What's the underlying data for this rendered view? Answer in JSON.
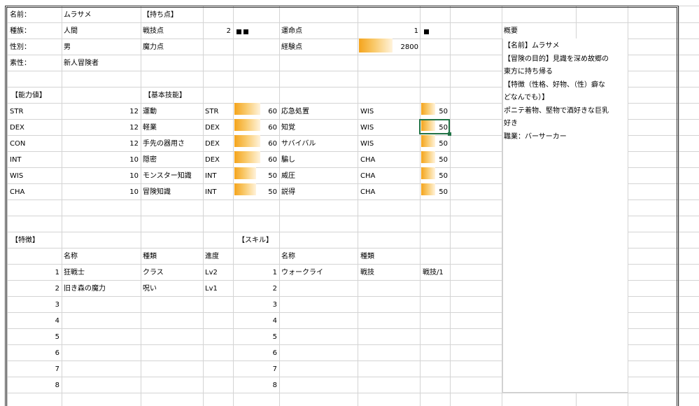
{
  "profile": {
    "name_label": "名前：",
    "name_value": "ムラサメ",
    "race_label": "種族：",
    "race_value": "人間",
    "gender_label": "性別：",
    "gender_value": "男",
    "origin_label": "素性：",
    "origin_value": "新人冒険者"
  },
  "points": {
    "header": "【持ち点】",
    "combat_label": "戦技点",
    "combat_value": "2",
    "magic_label": "魔力点",
    "fate_label": "運命点",
    "fate_value": "1",
    "exp_label": "経験点",
    "exp_value": "2800"
  },
  "abilities": {
    "header": "【能力値】",
    "rows": [
      {
        "name": "STR",
        "value": "12"
      },
      {
        "name": "DEX",
        "value": "12"
      },
      {
        "name": "CON",
        "value": "12"
      },
      {
        "name": "INT",
        "value": "10"
      },
      {
        "name": "WIS",
        "value": "10"
      },
      {
        "name": "CHA",
        "value": "10"
      }
    ]
  },
  "basic_skills": {
    "header": "【基本技能】",
    "left": [
      {
        "name": "運動",
        "stat": "STR",
        "value": "60"
      },
      {
        "name": "軽業",
        "stat": "DEX",
        "value": "60"
      },
      {
        "name": "手先の器用さ",
        "stat": "DEX",
        "value": "60"
      },
      {
        "name": "隠密",
        "stat": "DEX",
        "value": "60"
      },
      {
        "name": "モンスター知識",
        "stat": "INT",
        "value": "50"
      },
      {
        "name": "冒険知識",
        "stat": "INT",
        "value": "50"
      }
    ],
    "right": [
      {
        "name": "応急処置",
        "stat": "WIS",
        "value": "50"
      },
      {
        "name": "知覚",
        "stat": "WIS",
        "value": "50"
      },
      {
        "name": "サバイバル",
        "stat": "WIS",
        "value": "50"
      },
      {
        "name": "騙し",
        "stat": "CHA",
        "value": "50"
      },
      {
        "name": "威圧",
        "stat": "CHA",
        "value": "50"
      },
      {
        "name": "説得",
        "stat": "CHA",
        "value": "50"
      }
    ]
  },
  "features": {
    "header": "【特徴】",
    "col_name": "名称",
    "col_type": "種類",
    "col_progress": "進度",
    "rows": [
      {
        "no": "1",
        "name": "狂戦士",
        "type": "クラス",
        "progress": "Lv2"
      },
      {
        "no": "2",
        "name": "旧き森の魔力",
        "type": "呪い",
        "progress": "Lv1"
      },
      {
        "no": "3"
      },
      {
        "no": "4"
      },
      {
        "no": "5"
      },
      {
        "no": "6"
      },
      {
        "no": "7"
      },
      {
        "no": "8"
      }
    ]
  },
  "skills": {
    "header": "【スキル】",
    "col_name": "名称",
    "col_type": "種類",
    "rows": [
      {
        "no": "1",
        "name": "ウォークライ",
        "type": "戦技",
        "cost": "戦技/1"
      },
      {
        "no": "2"
      },
      {
        "no": "3"
      },
      {
        "no": "4"
      },
      {
        "no": "5"
      },
      {
        "no": "6"
      },
      {
        "no": "7"
      },
      {
        "no": "8"
      }
    ]
  },
  "summary": {
    "title": "概要",
    "lines": [
      "【名前】ムラサメ",
      "【冒険の目的】見識を深め故郷の",
      "東方に持ち帰る",
      "【特徴（性格、好物、（性）癖な",
      "どなんでも）】",
      "ポニテ着物、堅物で酒好きな巨乳",
      "好き",
      "職業：バーサーカー"
    ]
  },
  "colors": {
    "bar": "#f4a41d",
    "selection": "#217346",
    "grid": "#d4d4d4"
  },
  "bars": {
    "exp": 1.0,
    "combat_pips": 2,
    "fate_pips": 1
  }
}
